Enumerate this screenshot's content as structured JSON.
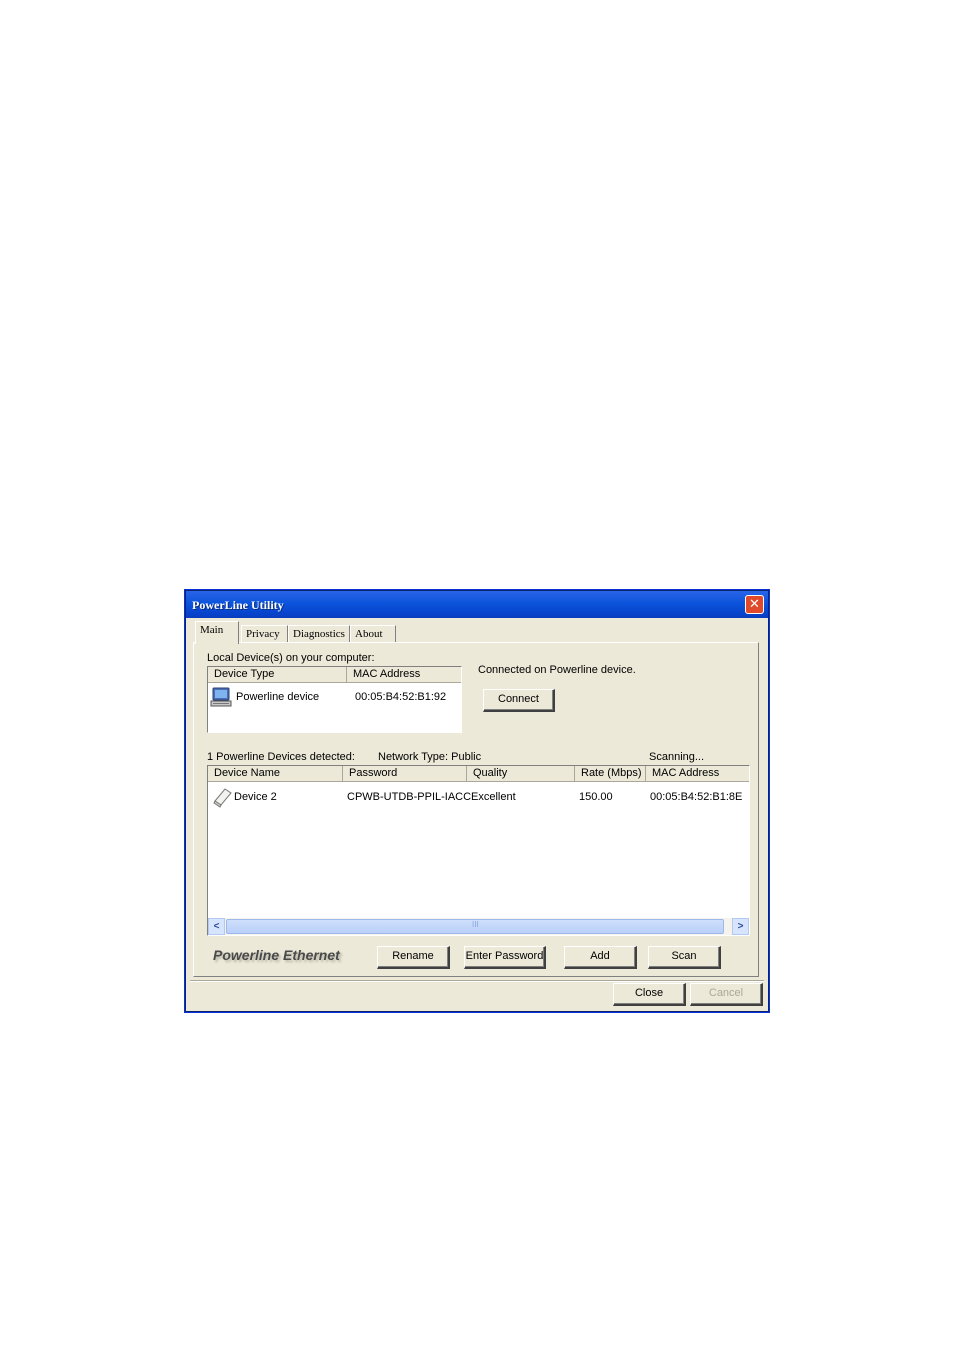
{
  "window": {
    "title": "PowerLine Utility",
    "close_glyph": "✕"
  },
  "tabs": [
    {
      "label": "Main"
    },
    {
      "label": "Privacy"
    },
    {
      "label": "Diagnostics"
    },
    {
      "label": "About"
    }
  ],
  "local": {
    "heading": "Local Device(s) on your computer:",
    "columns": [
      "Device Type",
      "MAC Address"
    ],
    "rows": [
      {
        "icon": "computer-icon",
        "type": "Powerline device",
        "mac": "00:05:B4:52:B1:92"
      }
    ],
    "status": "Connected on Powerline device.",
    "connect_label": "Connect"
  },
  "remote": {
    "detected": "1 Powerline Devices detected:",
    "network_type": "Network Type: Public",
    "scanning": "Scanning...",
    "columns": [
      "Device Name",
      "Password",
      "Quality",
      "Rate (Mbps)",
      "MAC Address"
    ],
    "rows": [
      {
        "icon": "powerline-adapter-icon",
        "name": "Device 2",
        "password": "CPWB-UTDB-PPIL-IACC",
        "quality": "Excellent",
        "rate": "150.00",
        "mac": "00:05:B4:52:B1:8E"
      }
    ]
  },
  "brand": "Powerline Ethernet",
  "buttons": {
    "rename": "Rename",
    "enter_password": "Enter Password",
    "add": "Add",
    "scan": "Scan",
    "close": "Close",
    "cancel": "Cancel"
  },
  "scrollbar": {
    "left_glyph": "<",
    "right_glyph": ">",
    "grip_glyph": "III"
  },
  "colors": {
    "titlebar": "#0b54dc",
    "close_button": "#e04a2a",
    "dialog_bg": "#ece9d8"
  }
}
